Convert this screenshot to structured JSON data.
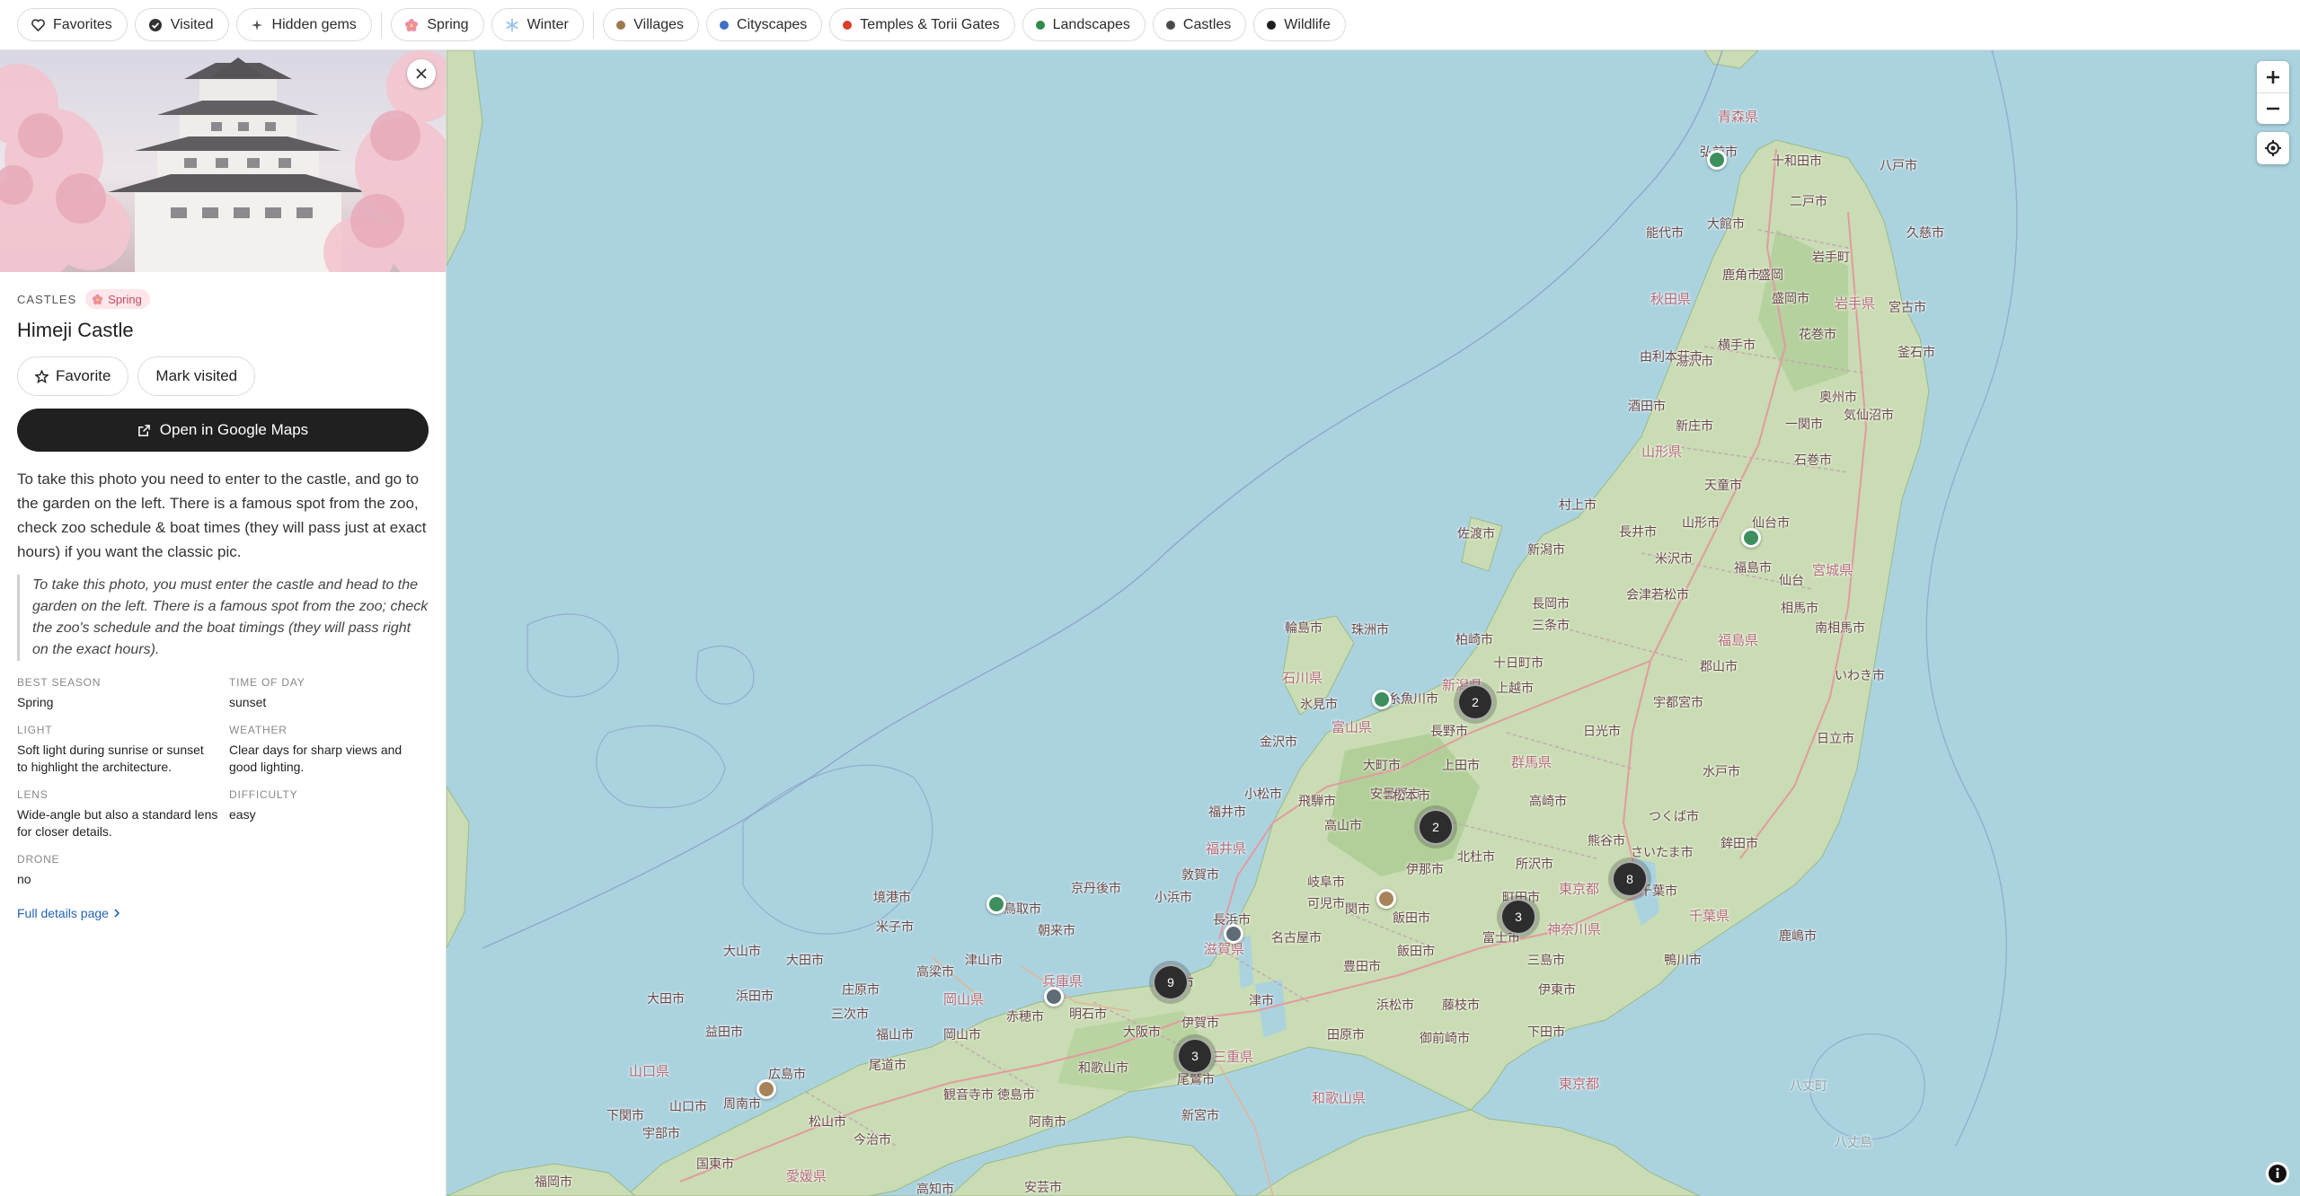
{
  "filters": {
    "chips": [
      {
        "label": "Favorites",
        "icon": "heart-icon"
      },
      {
        "label": "Visited",
        "icon": "check-circle-icon"
      },
      {
        "label": "Hidden gems",
        "icon": "sparkle-icon"
      }
    ],
    "seasons": [
      {
        "label": "Spring",
        "icon": "sakura-icon",
        "color": "#e8718a"
      },
      {
        "label": "Winter",
        "icon": "snowflake-icon",
        "color": "#8fb8e0"
      }
    ],
    "categories": [
      {
        "label": "Villages",
        "color": "#9b7a4e"
      },
      {
        "label": "Cityscapes",
        "color": "#3f6fc4"
      },
      {
        "label": "Temples & Torii Gates",
        "color": "#d9402b"
      },
      {
        "label": "Landscapes",
        "color": "#2f8a4c"
      },
      {
        "label": "Castles",
        "color": "#4a4a4a"
      },
      {
        "label": "Wildlife",
        "color": "#1f1f1f"
      }
    ]
  },
  "panel": {
    "category": "CASTLES",
    "season": "Spring",
    "title": "Himeji Castle",
    "favorite_label": "Favorite",
    "visited_label": "Mark visited",
    "gmaps_label": "Open in Google Maps",
    "description": "To take this photo you need to enter to the castle, and go to the garden on the left. There is a famous spot from the zoo, check zoo schedule & boat times (they will pass just at exact hours) if you want the classic pic.",
    "quote": "To take this photo, you must enter the castle and head to the garden on the left. There is a famous spot from the zoo; check the zoo's schedule and the boat timings (they will pass right on the exact hours).",
    "facts": {
      "best_season_label": "BEST SEASON",
      "best_season": "Spring",
      "time_of_day_label": "TIME OF DAY",
      "time_of_day": "sunset",
      "light_label": "LIGHT",
      "light": "Soft light during sunrise or sunset to highlight the architecture.",
      "weather_label": "WEATHER",
      "weather": "Clear days for sharp views and good lighting.",
      "lens_label": "LENS",
      "lens": "Wide-angle but also a standard lens for closer details.",
      "difficulty_label": "DIFFICULTY",
      "difficulty": "easy",
      "drone_label": "DRONE",
      "drone": "no"
    },
    "details_link": "Full details page"
  },
  "map": {
    "clusters": [
      "2",
      "2",
      "8",
      "3",
      "9",
      "3"
    ],
    "pins": [
      {
        "category": "Landscapes",
        "color": "#3d8f5e"
      },
      {
        "category": "Landscapes",
        "color": "#3d8f5e"
      },
      {
        "category": "Landscapes",
        "color": "#3d8f5e"
      },
      {
        "category": "Landscapes",
        "color": "#3d8f5e"
      },
      {
        "category": "Villages",
        "color": "#a7835a"
      },
      {
        "category": "Villages",
        "color": "#a7835a"
      },
      {
        "category": "Castles",
        "color": "#5f6b75"
      },
      {
        "category": "Castles",
        "color": "#5f6b75"
      }
    ],
    "labels": [
      "弘前市",
      "十和田市",
      "八戸市",
      "青森県",
      "大館市",
      "二戸市",
      "能代市",
      "久慈市",
      "秋田県",
      "盛岡市",
      "岩手県",
      "宮古市",
      "湯沢市",
      "横手市",
      "花巻市",
      "釜石市",
      "由利本荘市",
      "奥州市",
      "酒田市",
      "新庄市",
      "一関市",
      "気仙沼市",
      "山形県",
      "天童市",
      "石巻市",
      "村上市",
      "仙台市",
      "山形市",
      "長井市",
      "米沢市",
      "福島市",
      "宮城県",
      "佐渡市",
      "新潟市",
      "会津若松市",
      "相馬市",
      "郡山市",
      "福島県",
      "南相馬市",
      "輪島市",
      "珠洲市",
      "柏崎市",
      "十日町市",
      "糸魚川市",
      "上越市",
      "新潟県",
      "石川県",
      "氷見市",
      "富山県",
      "長野市",
      "日光市",
      "小松市",
      "金沢市",
      "大町市",
      "群馬県",
      "水戸市",
      "福井市",
      "飛騨市",
      "安曇野市",
      "高崎市",
      "つくば市",
      "高山市",
      "北杜市",
      "所沢市",
      "鉾田市",
      "さいたま市",
      "福井県",
      "伊那市",
      "東京都",
      "千葉市",
      "敦賀市",
      "可児市",
      "飯田市",
      "町田市",
      "千葉県",
      "名古屋市",
      "富士市",
      "神奈川県",
      "長浜市",
      "滋賀県",
      "豊田市",
      "三島市",
      "鴨川市",
      "京都市",
      "津市",
      "浜松市",
      "藤枝市",
      "伊東市",
      "下田市",
      "大阪市",
      "伊賀市",
      "田原市",
      "御前崎市",
      "八丈町",
      "東京都",
      "鳥取市",
      "京丹後市",
      "小浜市",
      "朝来市",
      "米子市",
      "境港市",
      "津山市",
      "大田市",
      "庄原市",
      "兵庫県",
      "明石市",
      "岡山市",
      "三次市",
      "赤穂市",
      "福山市",
      "岡山県",
      "和歌山市",
      "広島市",
      "尾道市",
      "三重県",
      "周南市",
      "松山市",
      "観音寺市",
      "徳島市",
      "阿南市",
      "新宮市",
      "尾鷲市",
      "山口県",
      "下関市",
      "宇部市",
      "福岡市",
      "国東市",
      "今治市",
      "愛媛県",
      "高知市",
      "安芸市",
      "大山市",
      "浜田市",
      "山口市",
      "益田市",
      "和歌山県",
      "高梁市",
      "大田市",
      "八丈島",
      "飯田市",
      "鹿嶋市",
      "熊谷市",
      "日立市",
      "いわき市",
      "宇都宮市",
      "上田市",
      "松本市",
      "関市",
      "岐阜市",
      "長岡市",
      "三条市",
      "岩手町",
      "鹿角市",
      "盛岡",
      "仙台"
    ]
  }
}
